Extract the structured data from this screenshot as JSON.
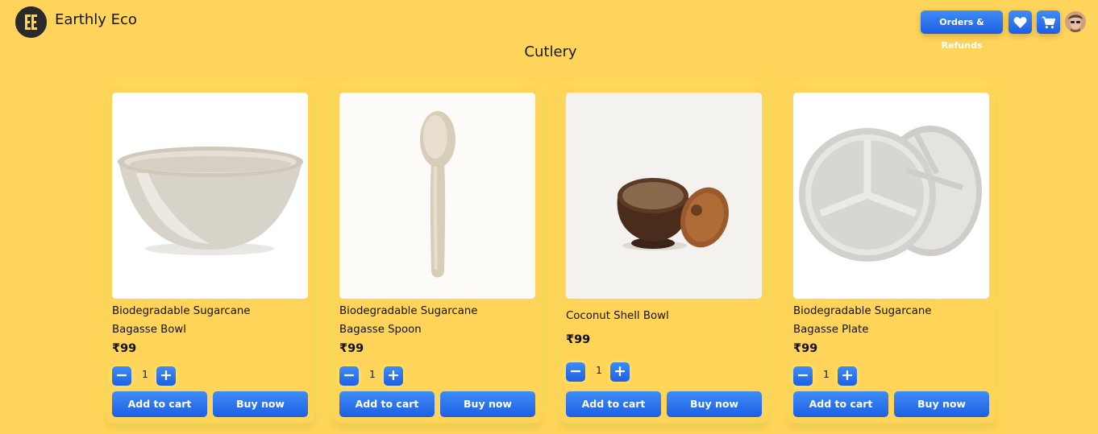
{
  "header": {
    "brand": "Earthly Eco",
    "logo_text": "EE",
    "orders_label": "Orders & Refunds",
    "favorites_icon": "heart-icon",
    "cart_icon": "cart-icon",
    "accent": "#2f76ee"
  },
  "page": {
    "title": "Cutlery",
    "background": "#ffd45a"
  },
  "products": [
    {
      "name_line1": "Biodegradable Sugarcane",
      "name_line2": "Bagasse Bowl",
      "price": "₹99",
      "qty": "1",
      "minus": "−",
      "plus": "+",
      "add_label": "Add to cart",
      "buy_label": "Buy now",
      "image": "bagasse-bowl-image"
    },
    {
      "name_line1": "Biodegradable Sugarcane",
      "name_line2": "Bagasse Spoon",
      "price": "₹99",
      "qty": "1",
      "minus": "−",
      "plus": "+",
      "add_label": "Add to cart",
      "buy_label": "Buy now",
      "image": "bagasse-spoon-image"
    },
    {
      "name_line1": "Coconut Shell Bowl",
      "name_line2": "",
      "price": "₹99",
      "qty": "1",
      "minus": "−",
      "plus": "+",
      "add_label": "Add to cart",
      "buy_label": "Buy now",
      "image": "coconut-shell-bowl-image"
    },
    {
      "name_line1": "Biodegradable Sugarcane",
      "name_line2": "Bagasse Plate",
      "price": "₹99",
      "qty": "1",
      "minus": "−",
      "plus": "+",
      "add_label": "Add to cart",
      "buy_label": "Buy now",
      "image": "bagasse-plate-image"
    }
  ]
}
